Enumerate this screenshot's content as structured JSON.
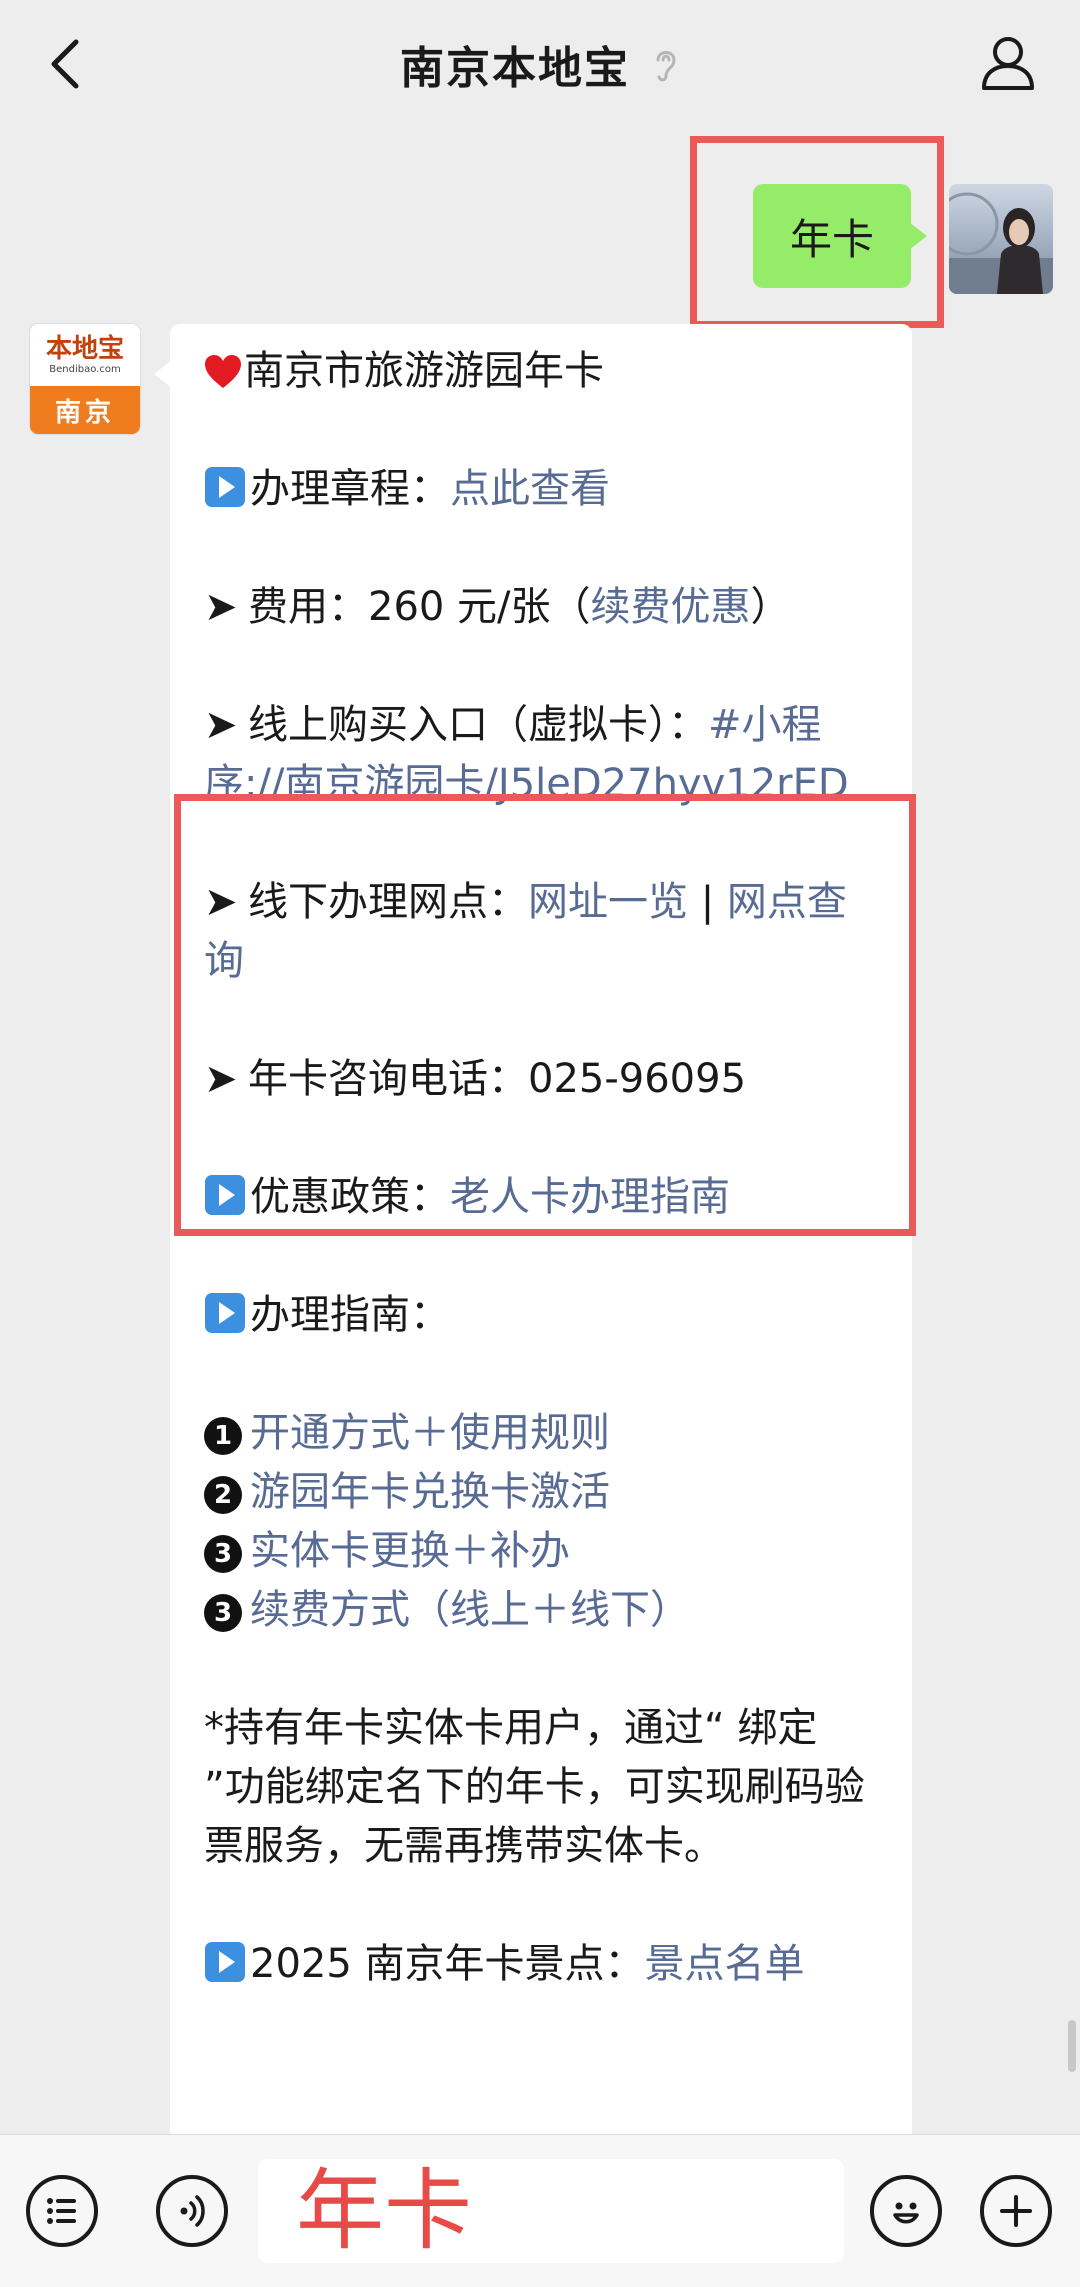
{
  "header": {
    "title": "南京本地宝"
  },
  "outgoing": {
    "text": "年卡"
  },
  "brand": {
    "name": "本地宝",
    "sub": "Bendibao.com",
    "city": "南京"
  },
  "message": {
    "heading": "南京市旅游游园年卡",
    "rules_label": "办理章程：",
    "rules_link": "点此查看",
    "fee_label": "费用：260 元/张（",
    "fee_link": "续费优惠",
    "fee_close": "）",
    "online_label": "线上购买入口（虚拟卡）：",
    "online_link": "#小程序://南京游园卡/J5leD27hyv12rED",
    "offline_label": "线下办理网点：",
    "offline_link1": "网址一览",
    "offline_sep": " | ",
    "offline_link2": "网点查询",
    "phone": "年卡咨询电话：025-96095",
    "policy_label": "优惠政策：",
    "policy_link": "老人卡办理指南",
    "guide_label": "办理指南：",
    "guide_items": [
      {
        "num": "1",
        "text": "开通方式＋使用规则"
      },
      {
        "num": "2",
        "text": "游园年卡兑换卡激活"
      },
      {
        "num": "3",
        "text": "实体卡更换＋补办"
      },
      {
        "num": "3",
        "text": "续费方式（线上＋线下）"
      }
    ],
    "note": "*持有年卡实体卡用户，通过“ 绑定 ”功能绑定名下的年卡，可实现刷码验票服务，无需再携带实体卡。",
    "spots_label": "2025 南京年卡景点：",
    "spots_link": "景点名单"
  },
  "input": {
    "value": "年卡"
  },
  "colors": {
    "link": "#576b95",
    "outgoing_bubble": "#95ec69",
    "highlight": "#e95a59"
  }
}
